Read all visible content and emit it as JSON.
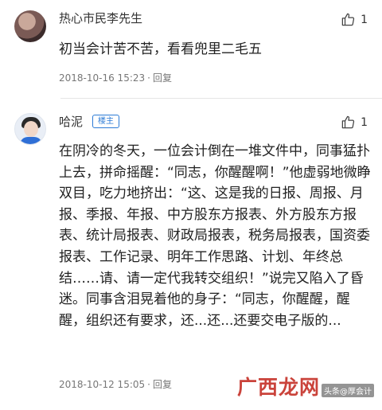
{
  "comments": [
    {
      "username": "热心市民李先生",
      "likes": "1",
      "text": "初当会计苦不苦，看看兜里二毛五",
      "date": "2018-10-16 15:23",
      "separator": "·",
      "reply": "回复"
    },
    {
      "username": "哈泥",
      "badge": "楼主",
      "likes": "1",
      "text": "在阴冷的冬天，一位会计倒在一堆文件中，同事猛扑上去，拼命摇醒：“同志，你醒醒啊！”他虚弱地微睁双目，吃力地挤出：“这、这是我的日报、周报、月报、季报、年报、中方股东方报表、外方股东方报表、统计局报表、财政局报表，税务局报表，国资委报表、工作记录、明年工作思路、计划、年终总结……请、请一定代我转交组织！”说完又陷入了昏迷。同事含泪晃着他的身子：“同志，你醒醒，醒醒，组织还有要求，还...还...还要交电子版的...",
      "date": "2018-10-12 15:05",
      "separator": "·",
      "reply": "回复"
    }
  ],
  "watermark": {
    "main": "广西龙网",
    "sub": "头条@厚会计"
  },
  "icons": {
    "like": "thumbs-up-icon"
  }
}
